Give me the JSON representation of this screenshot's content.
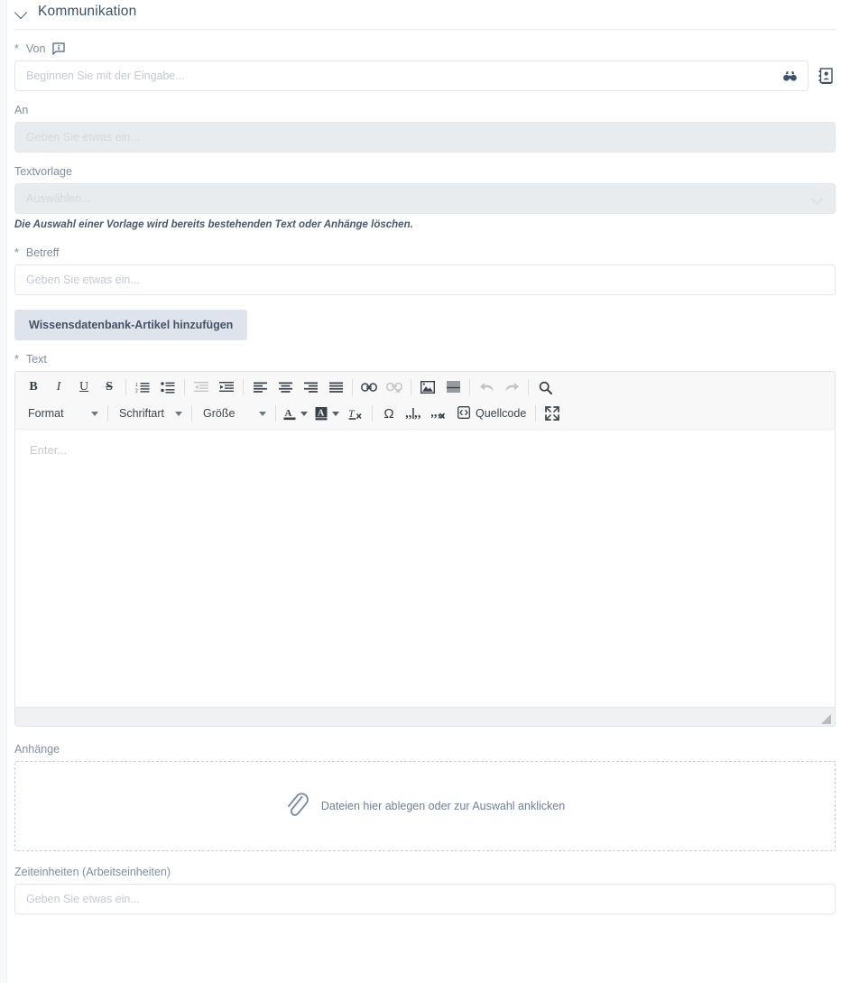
{
  "section": {
    "title": "Kommunikation",
    "collapse_icon": "chevron-down-icon"
  },
  "fields": {
    "from": {
      "label": "Von",
      "required_marker": "*",
      "info_icon": "info-bubble-icon",
      "placeholder": "Beginnen Sie mit der Eingabe...",
      "value": "",
      "inline_icon": "binoculars-icon",
      "side_icon": "address-book-icon"
    },
    "to": {
      "label": "An",
      "placeholder": "Geben Sie etwas ein...",
      "value": "",
      "disabled": true
    },
    "template": {
      "label": "Textvorlage",
      "placeholder": "Auswählen...",
      "value": "",
      "disabled": true,
      "chevron_icon": "chevron-down-icon",
      "hint": "Die Auswahl einer Vorlage wird bereits bestehenden Text oder Anhänge löschen."
    },
    "subject": {
      "label": "Betreff",
      "required_marker": "*",
      "placeholder": "Geben Sie etwas ein...",
      "value": ""
    },
    "kb_button": {
      "label": "Wissensdatenbank-Artikel hinzufügen"
    },
    "body": {
      "label": "Text",
      "required_marker": "*",
      "placeholder": "Enter...",
      "value": ""
    },
    "attachments": {
      "label": "Anhänge",
      "dropzone_text": "Dateien hier ablegen oder zur Auswahl anklicken",
      "dropzone_icon": "paperclip-icon"
    },
    "time_units": {
      "label": "Zeiteinheiten (Arbeitseinheiten)",
      "placeholder": "Geben Sie etwas ein...",
      "value": ""
    }
  },
  "editor_toolbar": {
    "row1": [
      {
        "name": "bold-icon",
        "type": "icon",
        "label": "B",
        "disabled": false
      },
      {
        "name": "italic-icon",
        "type": "icon",
        "label": "I",
        "disabled": false
      },
      {
        "name": "underline-icon",
        "type": "icon",
        "label": "U",
        "disabled": false
      },
      {
        "name": "strikethrough-icon",
        "type": "icon",
        "label": "S",
        "disabled": false
      },
      {
        "name": "separator",
        "type": "sep"
      },
      {
        "name": "numbered-list-icon",
        "type": "icon",
        "disabled": false
      },
      {
        "name": "bulleted-list-icon",
        "type": "icon",
        "disabled": false
      },
      {
        "name": "separator",
        "type": "sep"
      },
      {
        "name": "outdent-icon",
        "type": "icon",
        "disabled": true
      },
      {
        "name": "indent-icon",
        "type": "icon",
        "disabled": false
      },
      {
        "name": "separator",
        "type": "sep"
      },
      {
        "name": "align-left-icon",
        "type": "icon",
        "disabled": false
      },
      {
        "name": "align-center-icon",
        "type": "icon",
        "disabled": false
      },
      {
        "name": "align-right-icon",
        "type": "icon",
        "disabled": false
      },
      {
        "name": "align-justify-icon",
        "type": "icon",
        "disabled": false
      },
      {
        "name": "separator",
        "type": "sep"
      },
      {
        "name": "link-icon",
        "type": "icon",
        "disabled": false
      },
      {
        "name": "unlink-icon",
        "type": "icon",
        "disabled": true
      },
      {
        "name": "separator",
        "type": "sep"
      },
      {
        "name": "image-icon",
        "type": "icon",
        "disabled": false
      },
      {
        "name": "horizontal-rule-icon",
        "type": "icon",
        "disabled": false
      },
      {
        "name": "separator",
        "type": "sep"
      },
      {
        "name": "undo-icon",
        "type": "icon",
        "disabled": true
      },
      {
        "name": "redo-icon",
        "type": "icon",
        "disabled": true
      },
      {
        "name": "separator",
        "type": "sep"
      },
      {
        "name": "find-icon",
        "type": "icon",
        "disabled": false
      }
    ],
    "dropdowns": {
      "format": "Format",
      "font": "Schriftart",
      "size": "Größe"
    },
    "row2_icons": [
      {
        "name": "text-color-icon",
        "label": "A"
      },
      {
        "name": "background-color-icon",
        "label": "A"
      },
      {
        "name": "remove-format-icon"
      },
      {
        "name": "special-character-icon",
        "label": "Ω"
      },
      {
        "name": "insert-quote-icon"
      },
      {
        "name": "remove-quote-icon"
      },
      {
        "name": "maximize-icon"
      }
    ],
    "source_button": "Quellcode"
  },
  "colors": {
    "accent": "#4a6076",
    "label": "#7e8fa3",
    "button_bg": "#dfe4ec",
    "button_text": "#41536a",
    "toolbar_bg": "#f8f8f8",
    "disabled_bg": "#e9ecef",
    "dropzone_border": "#c5cdd8",
    "dropzone_text": "#6f8199"
  }
}
